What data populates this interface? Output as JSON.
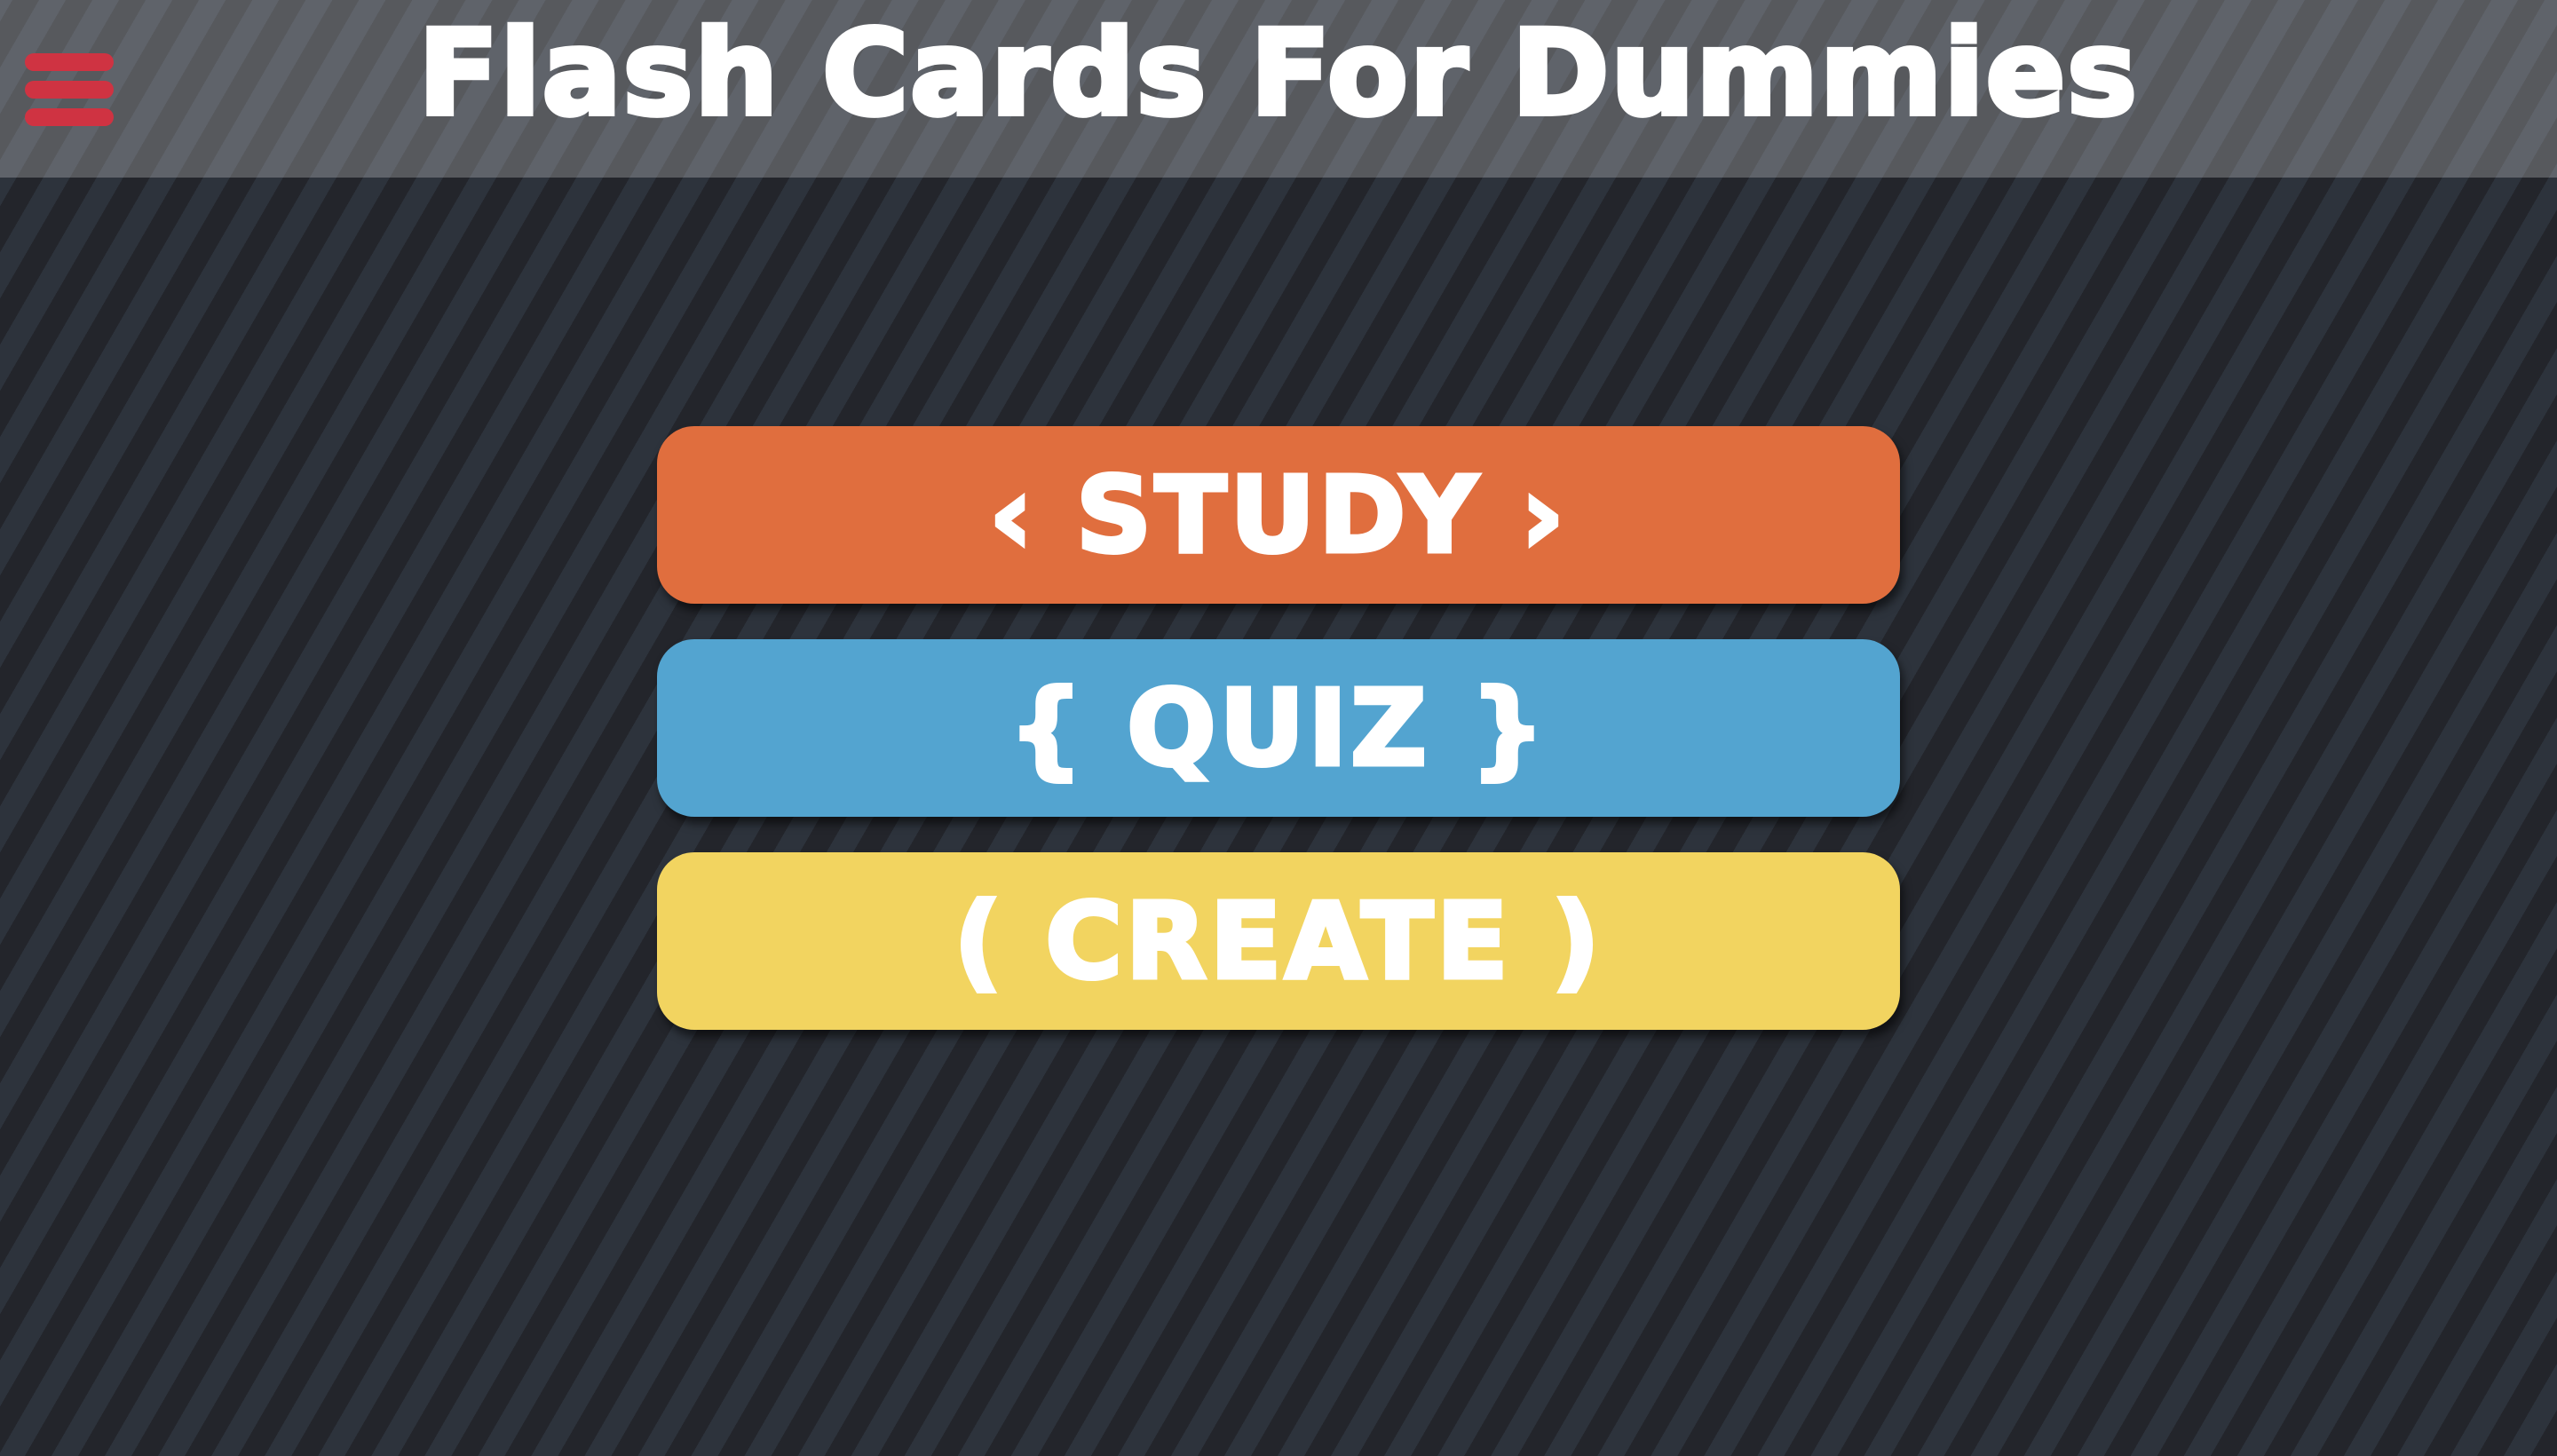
{
  "header": {
    "title": "Flash Cards For Dummies",
    "menu_icon": "hamburger-menu-icon"
  },
  "menu": {
    "buttons": [
      {
        "label": "‹ STUDY ›",
        "color": "#e06e3e"
      },
      {
        "label": "{ QUIZ }",
        "color": "#53a4d0"
      },
      {
        "label": "( CREATE )",
        "color": "#f2d460"
      }
    ]
  },
  "colors": {
    "menu_icon": "#cf3342",
    "background_dark": "#23252b",
    "background_light": "#2d333c"
  }
}
